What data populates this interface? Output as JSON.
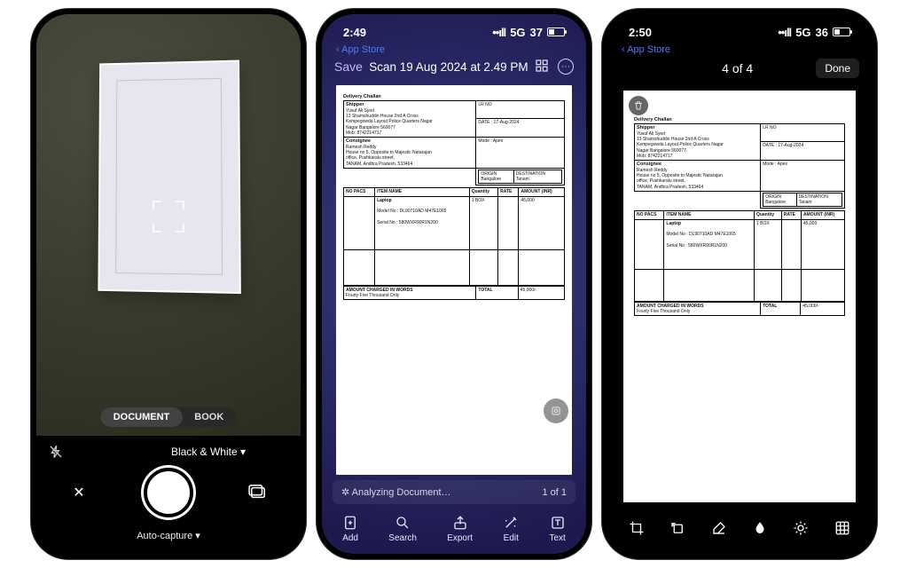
{
  "phone1": {
    "mode_doc": "DOCUMENT",
    "mode_book": "BOOK",
    "filter": "Black & White ▾",
    "autocap": "Auto-capture ▾"
  },
  "phone2": {
    "time": "2:49",
    "network": "5G",
    "battery": "37",
    "back": "‹ App Store",
    "save": "Save",
    "title": "Scan 19 Aug 2024 at 2.49 PM",
    "analyzing": "✲  Analyzing Document…",
    "page": "1 of 1",
    "tools": {
      "add": "Add",
      "search": "Search",
      "export": "Export",
      "edit": "Edit",
      "text": "Text"
    }
  },
  "phone3": {
    "time": "2:50",
    "network": "5G",
    "battery": "36",
    "back": "‹ App Store",
    "pager": "4 of 4",
    "done": "Done"
  },
  "document": {
    "title": "Delivery Challan",
    "lr_no": "LR NO",
    "date_lbl": "DATE",
    "date": "17-Aug-2024",
    "consignor_head": "Shipper",
    "consignor_name": "Yusuf Ali Syed",
    "consignor_addr1": "13 Shamshuddin House 2nd A Cross",
    "consignor_addr2": "Kempegowda Layout Police Quarters Nagar",
    "consignor_addr3": "Nagar Bangalore 560077",
    "consignor_ph": "Mob: 8742214717",
    "consignee_head": "Consignee",
    "consignee_name": "Ramesh Reddy",
    "consignee_addr1": "House no 5, Opposite to Majestic Natarajan",
    "consignee_addr2": "office, Pushkaralu street,",
    "consignee_addr3": "TANAM, Andhra Pradesh, 533464",
    "mode_lbl": "Mode",
    "mode": "Apex",
    "origin": "ORIGIN",
    "origin_v": "Bangalore",
    "dest": "DESTINATION",
    "dest_v": "Tanam",
    "th_no": "NO PACS",
    "th_item": "ITEM NAME",
    "th_qty": "Quantity",
    "th_rate": "RATE",
    "th_amt": "AMOUNT (INR)",
    "item": "Laptop",
    "model": "Model No : DL90710AD M47E1065",
    "serial": "Serial No : 580WXR90R1N200",
    "pcs": "1 BOX",
    "amt": "45,000",
    "words_lbl": "AMOUNT CHARGED IN WORDS",
    "words": "Fourty Five Thousand Only",
    "total_lbl": "TOTAL",
    "total": "45,000/-"
  }
}
